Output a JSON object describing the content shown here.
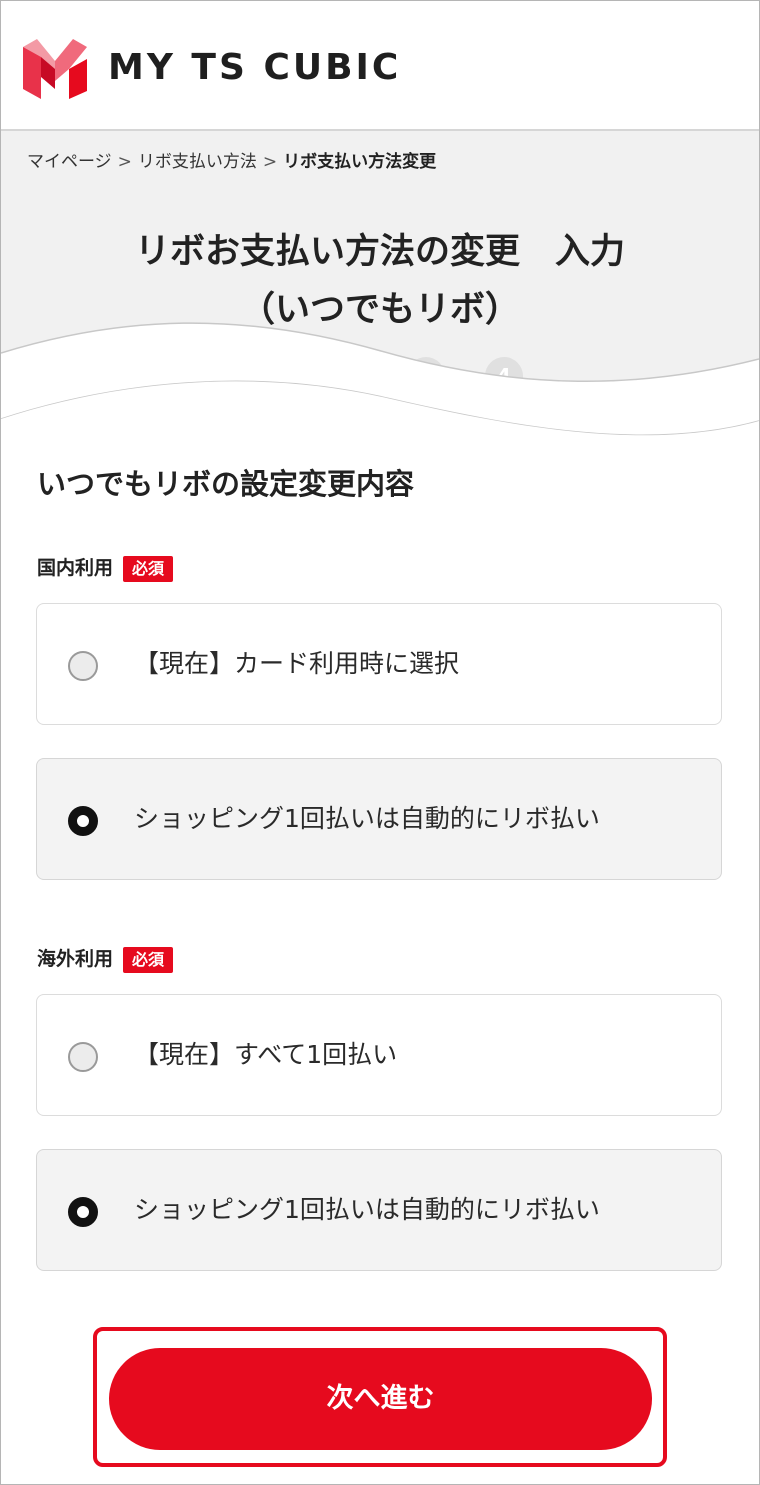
{
  "header": {
    "brand": "MY TS CUBIC",
    "logo_icon": "m-logo-icon",
    "brand_color": "#e60a1e"
  },
  "breadcrumb": {
    "items": [
      "マイページ",
      "リボ支払い方法"
    ],
    "separator": ">",
    "current": "リボ支払い方法変更"
  },
  "page": {
    "title_line1": "リボお支払い方法の変更　入力",
    "title_line2": "（いつでもリボ）",
    "step_visible": "4"
  },
  "form": {
    "section_title": "いつでもリボの設定変更内容",
    "required_badge": "必須",
    "groups": [
      {
        "label": "国内利用",
        "options": [
          {
            "label": "【現在】カード利用時に選択",
            "selected": false
          },
          {
            "label": "ショッピング1回払いは自動的にリボ払い",
            "selected": true
          }
        ]
      },
      {
        "label": "海外利用",
        "options": [
          {
            "label": "【現在】すべて1回払い",
            "selected": false
          },
          {
            "label": "ショッピング1回払いは自動的にリボ払い",
            "selected": true
          }
        ]
      }
    ]
  },
  "actions": {
    "next_label": "次へ進む"
  }
}
